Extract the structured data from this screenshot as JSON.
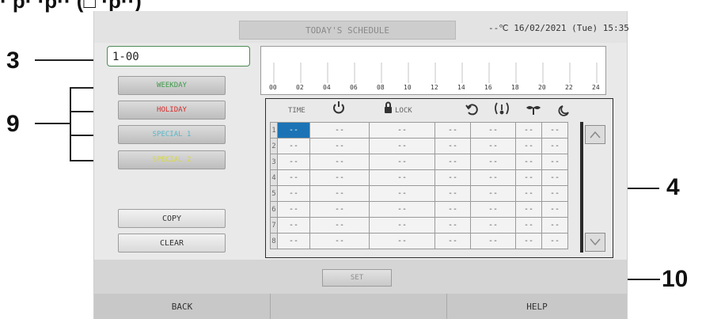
{
  "top_text": "· p· ·p·· (□ ·p··)",
  "header": {
    "title": "TODAY'S SCHEDULE",
    "temp_date": "--℃  16/02/2021 (Tue) 15:35"
  },
  "group_name": "1-00",
  "timeline_hours": [
    "00",
    "02",
    "04",
    "06",
    "08",
    "10",
    "12",
    "14",
    "16",
    "18",
    "20",
    "22",
    "24"
  ],
  "day_buttons": [
    {
      "label": "WEEKDAY",
      "color": "#3f9a4a"
    },
    {
      "label": "HOLIDAY",
      "color": "#d42c2c"
    },
    {
      "label": "SPECIAL 1",
      "color": "#57b7c9"
    },
    {
      "label": "SPECIAL 2",
      "color": "#d9d937"
    }
  ],
  "command_buttons": {
    "copy": "COPY",
    "clear": "CLEAR"
  },
  "table": {
    "headers": {
      "time": "TIME",
      "lock": "LOCK"
    },
    "header_icons": [
      "power-icon",
      "lock-icon",
      "mode-icon",
      "temperature-icon",
      "fan-speed-icon",
      "night-mode-icon"
    ],
    "rows": [
      {
        "n": "1",
        "cells": [
          "--",
          "--",
          "--",
          "--",
          "--",
          "--",
          "--"
        ]
      },
      {
        "n": "2",
        "cells": [
          "--",
          "--",
          "--",
          "--",
          "--",
          "--",
          "--"
        ]
      },
      {
        "n": "3",
        "cells": [
          "--",
          "--",
          "--",
          "--",
          "--",
          "--",
          "--"
        ]
      },
      {
        "n": "4",
        "cells": [
          "--",
          "--",
          "--",
          "--",
          "--",
          "--",
          "--"
        ]
      },
      {
        "n": "5",
        "cells": [
          "--",
          "--",
          "--",
          "--",
          "--",
          "--",
          "--"
        ]
      },
      {
        "n": "6",
        "cells": [
          "--",
          "--",
          "--",
          "--",
          "--",
          "--",
          "--"
        ]
      },
      {
        "n": "7",
        "cells": [
          "--",
          "--",
          "--",
          "--",
          "--",
          "--",
          "--"
        ]
      },
      {
        "n": "8",
        "cells": [
          "--",
          "--",
          "--",
          "--",
          "--",
          "--",
          "--"
        ]
      }
    ]
  },
  "set_label": "SET",
  "footer": {
    "back": "BACK",
    "help": "HELP"
  },
  "callouts": {
    "c3": "3",
    "c9": "9",
    "c4": "4",
    "c10": "10"
  }
}
